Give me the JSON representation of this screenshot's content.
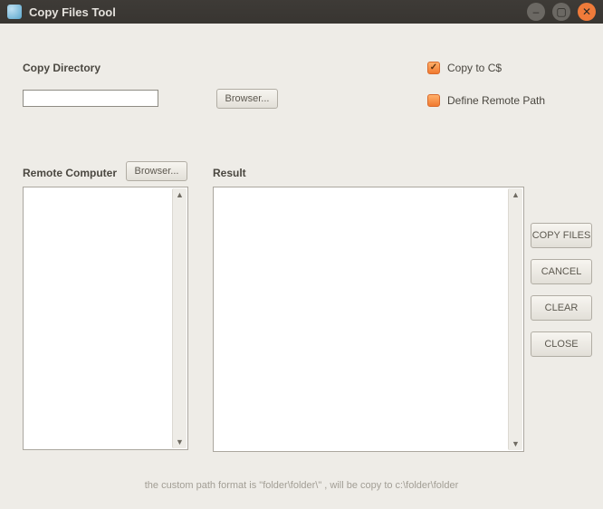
{
  "window": {
    "title": "Copy Files Tool"
  },
  "copy_directory": {
    "label": "Copy Directory",
    "value": "",
    "browse_label": "Browser..."
  },
  "options": {
    "copy_cs": {
      "label": "Copy to C$",
      "checked": true
    },
    "define_path": {
      "label": "Define Remote Path",
      "checked": false
    }
  },
  "remote": {
    "label": "Remote Computer",
    "browse_label": "Browser..."
  },
  "result": {
    "label": "Result"
  },
  "actions": {
    "copy": "COPY FILES",
    "cancel": "CANCEL",
    "clear": "CLEAR",
    "close": "CLOSE"
  },
  "hint": "the custom path  format is \"folder\\folder\\\" , will be copy to c:\\folder\\folder"
}
